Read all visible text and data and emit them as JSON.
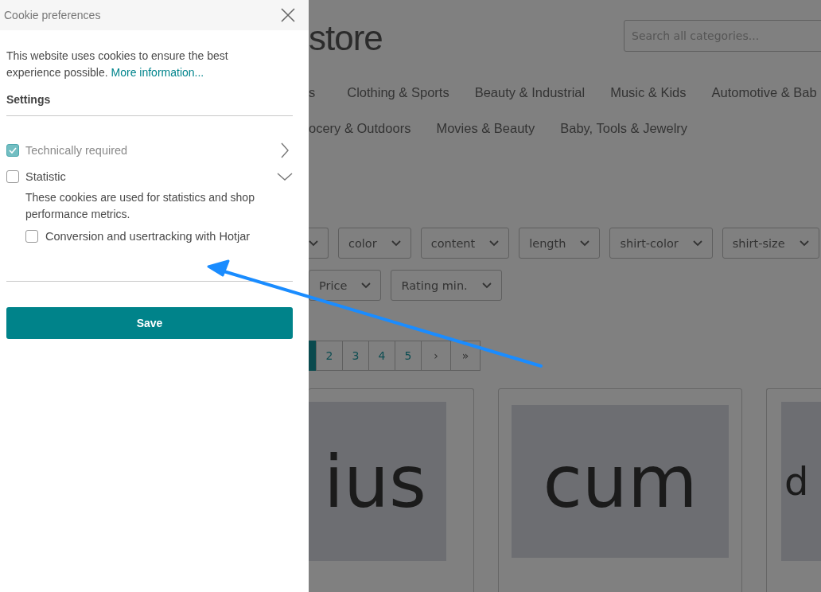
{
  "cookie_panel": {
    "title": "Cookie preferences",
    "intro": "This website uses cookies to ensure the best experience possible.",
    "more_link": "More information...",
    "settings_heading": "Settings",
    "groups": [
      {
        "label": "Technically required",
        "checked": true,
        "disabled": true,
        "expanded": false
      },
      {
        "label": "Statistic",
        "checked": false,
        "disabled": false,
        "expanded": true,
        "description": "These cookies are used for statistics and shop performance metrics.",
        "options": [
          {
            "label": "Conversion and usertracking with Hotjar",
            "checked": false
          }
        ]
      }
    ],
    "save_button": "Save"
  },
  "store_page": {
    "logo": "store",
    "search": {
      "placeholder": "Search all categories..."
    },
    "nav_rows": [
      [
        "s",
        "Clothing & Sports",
        "Beauty & Industrial",
        "Music & Kids",
        "Automotive & Bab"
      ],
      [
        "ocery & Outdoors",
        "Movies & Beauty",
        "Baby, Tools & Jewelry"
      ]
    ],
    "filter_rows": [
      [
        {
          "kind": "cut"
        },
        {
          "kind": "dropdown",
          "label": "color"
        },
        {
          "kind": "dropdown",
          "label": "content"
        },
        {
          "kind": "dropdown",
          "label": "length"
        },
        {
          "kind": "dropdown",
          "label": "shirt-color"
        },
        {
          "kind": "dropdown",
          "label": "shirt-size"
        },
        {
          "kind": "edge"
        }
      ],
      [
        {
          "kind": "dropdown",
          "label": "Price"
        },
        {
          "kind": "dropdown",
          "label": "Rating min."
        }
      ]
    ],
    "pagination": [
      {
        "kind": "cut",
        "selected": true
      },
      {
        "kind": "page",
        "label": "2",
        "selected": false
      },
      {
        "kind": "page",
        "label": "3",
        "selected": false
      },
      {
        "kind": "page",
        "label": "4",
        "selected": false
      },
      {
        "kind": "page",
        "label": "5",
        "selected": false
      },
      {
        "kind": "page",
        "label": "›",
        "selected": false
      },
      {
        "kind": "page",
        "label": "»",
        "selected": false
      }
    ],
    "products": [
      {
        "image_text": "ius"
      },
      {
        "image_text": "cum"
      },
      {
        "image_text": "d"
      }
    ]
  },
  "annotation": {
    "kind": "arrow"
  }
}
